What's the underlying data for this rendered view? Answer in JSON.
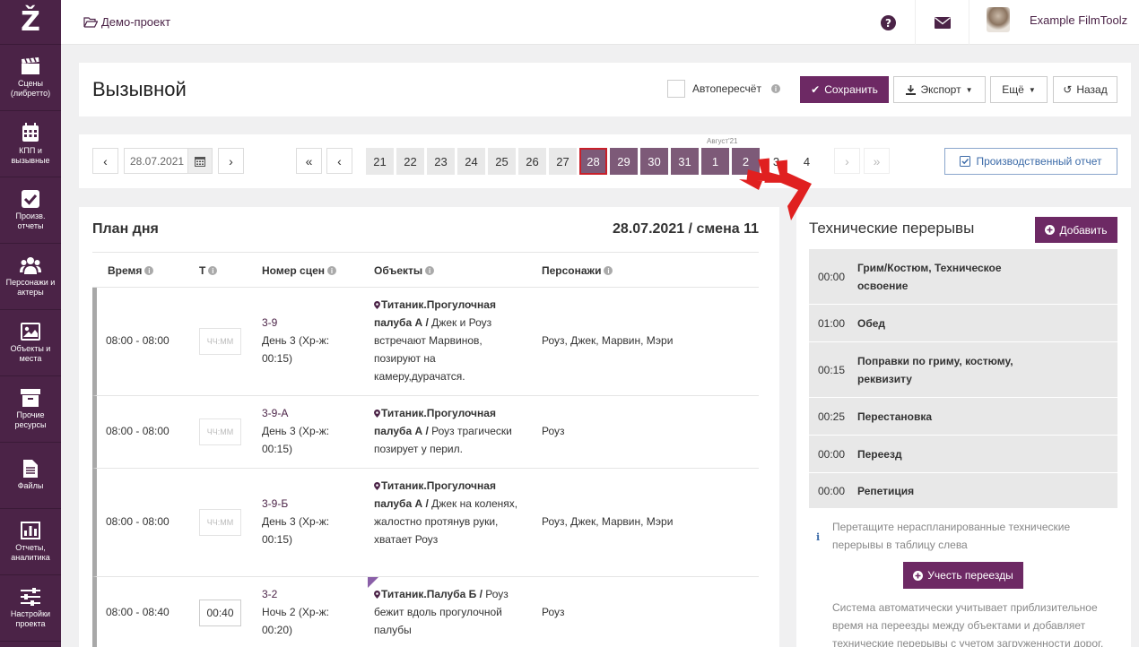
{
  "app": {
    "logo": "Ž"
  },
  "sidebar": {
    "items": [
      {
        "label": "Сцены (либретто)",
        "icon": "clapperboard-icon"
      },
      {
        "label": "КПП и вызывные",
        "icon": "calendar-icon"
      },
      {
        "label": "Произв. отчеты",
        "icon": "checkbox-icon"
      },
      {
        "label": "Персонажи и актеры",
        "icon": "people-icon"
      },
      {
        "label": "Объекты и места",
        "icon": "picture-icon"
      },
      {
        "label": "Прочие ресурсы",
        "icon": "archive-icon"
      },
      {
        "label": "Файлы",
        "icon": "file-icon"
      },
      {
        "label": "Отчеты, аналитика",
        "icon": "bar-chart-icon"
      },
      {
        "label": "Настройки проекта",
        "icon": "sliders-icon"
      }
    ]
  },
  "topbar": {
    "project": "Демо-проект",
    "user_name": "Example FilmToolz"
  },
  "header": {
    "title": "Вызывной",
    "auto_label": "Автопересчёт",
    "save_label": "Сохранить",
    "export_label": "Экспорт",
    "more_label": "Ещё",
    "back_label": "Назад"
  },
  "calendar": {
    "date": "28.07.2021",
    "month_label": "Август'21",
    "days": [
      "21",
      "22",
      "23",
      "24",
      "25",
      "26",
      "27",
      "28",
      "29",
      "30",
      "31",
      "1",
      "2",
      "3",
      "4"
    ],
    "current_day": "28",
    "first_label": "«",
    "prev_label": "‹",
    "next_label": "›",
    "last_label": "»",
    "report_label": "Производственный отчет"
  },
  "plan": {
    "title": "План дня",
    "date_shift": "28.07.2021 / смена 11",
    "columns": [
      "Время",
      "Т",
      "Номер сцен",
      "Объекты",
      "Персонажи"
    ],
    "rows": [
      {
        "time": "08:00 - 08:00",
        "t": "ЧЧ:ММ",
        "scene": "3-9",
        "scene_day": "День 3 (Хр-ж:",
        "scene_dur": "00:15)",
        "obj_bold": "Титаник.Прогулочная палуба А /",
        "obj_text": " Джек и Роуз встречают Марвинов, позируют на камеру,дурачатся.",
        "chars": "Роуз, Джек, Марвин, Мэри"
      },
      {
        "time": "08:00 - 08:00",
        "t": "ЧЧ:ММ",
        "scene": "3-9-А",
        "scene_day": "День 3 (Хр-ж:",
        "scene_dur": "00:15)",
        "obj_bold": "Титаник.Прогулочная палуба А /",
        "obj_text": " Роуз трагически позирует у перил.",
        "chars": "Роуз"
      },
      {
        "time": "08:00 - 08:00",
        "t": "ЧЧ:ММ",
        "scene": "3-9-Б",
        "scene_day": "День 3 (Хр-ж:",
        "scene_dur": "00:15)",
        "obj_bold": "Титаник.Прогулочная палуба А /",
        "obj_text": " Джек на коленях, жалостно протянув руки, хватает Роуз",
        "chars": "Роуз, Джек, Марвин, Мэри"
      },
      {
        "time": "08:00 - 08:40",
        "t": "00:40",
        "scene": "3-2",
        "scene_day": "Ночь 2 (Хр-ж:",
        "scene_dur": "00:20)",
        "obj_bold": "Титаник.Палуба Б /",
        "obj_text": " Роуз бежит вдоль прогулочной палубы",
        "chars": "Роуз"
      }
    ]
  },
  "breaks": {
    "title": "Технические перерывы",
    "add_label": "Добавить",
    "items": [
      {
        "time": "00:00",
        "name": "Грим/Костюм, Техническое освоение"
      },
      {
        "time": "01:00",
        "name": "Обед"
      },
      {
        "time": "00:15",
        "name": "Поправки по гриму, костюму, реквизиту"
      },
      {
        "time": "00:25",
        "name": "Перестановка"
      },
      {
        "time": "00:00",
        "name": "Переезд"
      },
      {
        "time": "00:00",
        "name": "Репетиция"
      }
    ],
    "hint": "Перетащите нераспланированные технические перерывы в таблицу слева",
    "transfer_label": "Учесть переезды",
    "description": "Система автоматически учитывает приблизительное время на переезды между объектами и добавляет технические перерывы с учетом загруженности дорог."
  },
  "colors": {
    "brand": "#4b2347",
    "accent": "#6d2964",
    "current_day_border": "#c8202a",
    "arrow": "#e02020"
  }
}
